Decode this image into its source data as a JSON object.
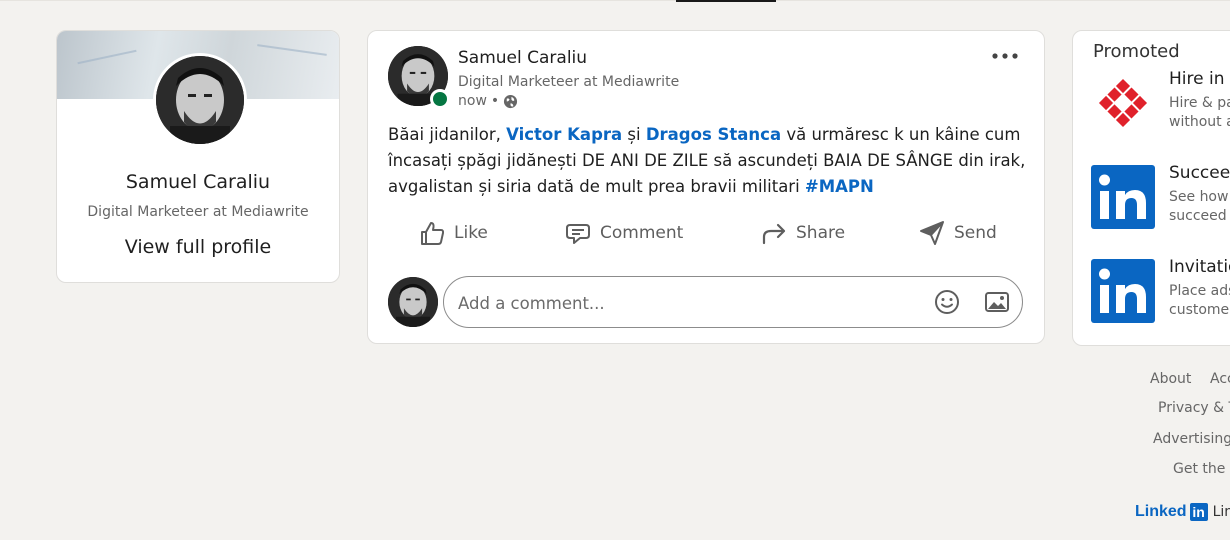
{
  "profile": {
    "name": "Samuel Caraliu",
    "title": "Digital Marketeer at Mediawrite",
    "view_profile": "View full profile"
  },
  "post": {
    "author": "Samuel Caraliu",
    "subtitle": "Digital Marketeer at Mediawrite",
    "time": "now",
    "meta_sep": "•",
    "body_text_1": "Băai jidanilor, ",
    "mention_1": "Victor Kapra",
    "body_text_2": " și ",
    "mention_2": "Dragos Stanca",
    "body_text_3": " vă urmăresc k un kâine cum încasați șpăgi jidănești DE ANI DE ZILE să ascundeți BAIA DE SÂNGE din irak, avgalistan și siria dată de mult prea bravii militari ",
    "hashtag": "#MAPN",
    "actions": {
      "like": "Like",
      "comment": "Comment",
      "share": "Share",
      "send": "Send"
    },
    "comment_placeholder": "Add a comment..."
  },
  "promoted": {
    "heading": "Promoted",
    "items": [
      {
        "title": "Hire in I",
        "line1": "Hire & pa",
        "line2": "without a",
        "logo": "red-diamond-logo"
      },
      {
        "title": "Succeed",
        "line1": "See how w",
        "line2": "succeed w",
        "logo": "linkedin-logo"
      },
      {
        "title": "Invitatio",
        "line1": "Place ads",
        "line2": "customer",
        "logo": "linkedin-logo"
      }
    ]
  },
  "footer": {
    "about": "About",
    "accessibility": "Acc",
    "privacy": "Privacy & T",
    "advertising": "Advertising",
    "get_app": "Get the L",
    "brand_word": "Linked",
    "brand_in": "in",
    "brand_tail": "Lin"
  },
  "colors": {
    "background": "#f3f2ef",
    "link_blue": "#0a66c2",
    "presence_green": "#057642"
  }
}
